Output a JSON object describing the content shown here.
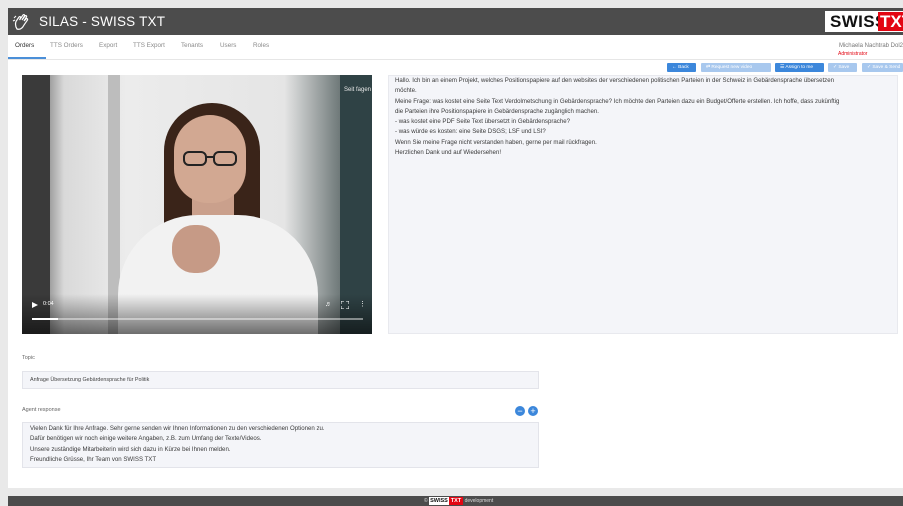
{
  "header": {
    "app_title": "SILAS - SWISS TXT",
    "brand_swiss": "SWISS",
    "brand_txt": "TXT",
    "logo_icon": "hand-sign-icon"
  },
  "nav": {
    "tabs": [
      {
        "label": "Orders",
        "active": true
      },
      {
        "label": "TTS Orders",
        "active": false
      },
      {
        "label": "Export",
        "active": false
      },
      {
        "label": "TTS Export",
        "active": false
      },
      {
        "label": "Tenants",
        "active": false
      },
      {
        "label": "Users",
        "active": false
      },
      {
        "label": "Roles",
        "active": false
      }
    ],
    "user_name": "Michaela Nachtrab Dol2",
    "user_role": "Administrator"
  },
  "actions": {
    "back": "← Back",
    "request_new_video": "⇄ Request new video",
    "assign_to_me": "☰ Assign to me",
    "save": "✓ Save",
    "save_and_send": "✓ Save & Send"
  },
  "video": {
    "time": "0:04",
    "progress": 0.08,
    "sign_text": "Seit fagen",
    "controls": [
      "play-icon",
      "volume-icon",
      "fullscreen-icon",
      "more-vertical-icon"
    ]
  },
  "message": {
    "lines": [
      "Hallo. Ich bin an einem Projekt, welches Positionspapiere auf den websites der verschiedenen politischen Parteien in der Schweiz in Gebärdensprache übersetzen",
      "möchte.",
      "Meine Frage: was kostet eine Seite Text Verdolmetschung in Gebärdensprache? Ich möchte den Parteien dazu ein Budget/Offerte erstellen. Ich hoffe, dass zukünftig",
      "die Parteien ihre Positionspapiere in Gebärdensprache zugänglich machen.",
      "- was kostet eine PDF Seite Text übersetzt in Gebärdensprache?",
      "- was würde es kosten: eine Seite DSGS; LSF und LSI?",
      "Wenn Sie meine Frage nicht verstanden haben, gerne per mail rückfragen.",
      "Herzlichen Dank und auf Wiedersehen!"
    ]
  },
  "topic": {
    "label": "Topic",
    "value": "Anfrage Übersetzung Gebärdensprache für Politik"
  },
  "agent_response": {
    "label": "Agent response",
    "lines": [
      "Vielen Dank für Ihre Anfrage. Sehr gerne senden wir Ihnen Informationen zu den verschiedenen Optionen zu.",
      "Dafür benötigen wir noch einige weitere Angaben, z.B. zum Umfang der Texte/Videos.",
      "Unsere zuständige Mitarbeiterin wird sich dazu in Kürze bei Ihnen melden.",
      "Freundliche Grüsse, Ihr Team von SWISS TXT"
    ],
    "remove_icon": "minus-circle-icon",
    "add_icon": "plus-circle-icon"
  },
  "footer": {
    "copyright": "©",
    "brand_swiss": "SWISS",
    "brand_txt": "TXT",
    "env": "development"
  },
  "colors": {
    "topbar": "#4c4c4c",
    "accent": "#3c87db",
    "brand_red": "#e30613",
    "panel": "#f4f5f9"
  }
}
